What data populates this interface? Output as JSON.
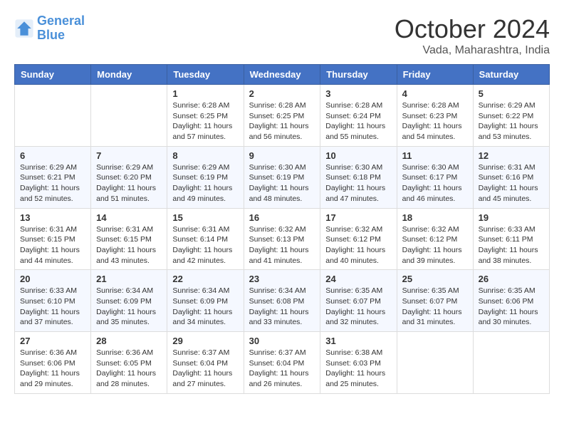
{
  "logo": {
    "line1": "General",
    "line2": "Blue"
  },
  "title": "October 2024",
  "location": "Vada, Maharashtra, India",
  "weekdays": [
    "Sunday",
    "Monday",
    "Tuesday",
    "Wednesday",
    "Thursday",
    "Friday",
    "Saturday"
  ],
  "weeks": [
    [
      {
        "day": "",
        "sunrise": "",
        "sunset": "",
        "daylight": ""
      },
      {
        "day": "",
        "sunrise": "",
        "sunset": "",
        "daylight": ""
      },
      {
        "day": "1",
        "sunrise": "Sunrise: 6:28 AM",
        "sunset": "Sunset: 6:25 PM",
        "daylight": "Daylight: 11 hours and 57 minutes."
      },
      {
        "day": "2",
        "sunrise": "Sunrise: 6:28 AM",
        "sunset": "Sunset: 6:25 PM",
        "daylight": "Daylight: 11 hours and 56 minutes."
      },
      {
        "day": "3",
        "sunrise": "Sunrise: 6:28 AM",
        "sunset": "Sunset: 6:24 PM",
        "daylight": "Daylight: 11 hours and 55 minutes."
      },
      {
        "day": "4",
        "sunrise": "Sunrise: 6:28 AM",
        "sunset": "Sunset: 6:23 PM",
        "daylight": "Daylight: 11 hours and 54 minutes."
      },
      {
        "day": "5",
        "sunrise": "Sunrise: 6:29 AM",
        "sunset": "Sunset: 6:22 PM",
        "daylight": "Daylight: 11 hours and 53 minutes."
      }
    ],
    [
      {
        "day": "6",
        "sunrise": "Sunrise: 6:29 AM",
        "sunset": "Sunset: 6:21 PM",
        "daylight": "Daylight: 11 hours and 52 minutes."
      },
      {
        "day": "7",
        "sunrise": "Sunrise: 6:29 AM",
        "sunset": "Sunset: 6:20 PM",
        "daylight": "Daylight: 11 hours and 51 minutes."
      },
      {
        "day": "8",
        "sunrise": "Sunrise: 6:29 AM",
        "sunset": "Sunset: 6:19 PM",
        "daylight": "Daylight: 11 hours and 49 minutes."
      },
      {
        "day": "9",
        "sunrise": "Sunrise: 6:30 AM",
        "sunset": "Sunset: 6:19 PM",
        "daylight": "Daylight: 11 hours and 48 minutes."
      },
      {
        "day": "10",
        "sunrise": "Sunrise: 6:30 AM",
        "sunset": "Sunset: 6:18 PM",
        "daylight": "Daylight: 11 hours and 47 minutes."
      },
      {
        "day": "11",
        "sunrise": "Sunrise: 6:30 AM",
        "sunset": "Sunset: 6:17 PM",
        "daylight": "Daylight: 11 hours and 46 minutes."
      },
      {
        "day": "12",
        "sunrise": "Sunrise: 6:31 AM",
        "sunset": "Sunset: 6:16 PM",
        "daylight": "Daylight: 11 hours and 45 minutes."
      }
    ],
    [
      {
        "day": "13",
        "sunrise": "Sunrise: 6:31 AM",
        "sunset": "Sunset: 6:15 PM",
        "daylight": "Daylight: 11 hours and 44 minutes."
      },
      {
        "day": "14",
        "sunrise": "Sunrise: 6:31 AM",
        "sunset": "Sunset: 6:15 PM",
        "daylight": "Daylight: 11 hours and 43 minutes."
      },
      {
        "day": "15",
        "sunrise": "Sunrise: 6:31 AM",
        "sunset": "Sunset: 6:14 PM",
        "daylight": "Daylight: 11 hours and 42 minutes."
      },
      {
        "day": "16",
        "sunrise": "Sunrise: 6:32 AM",
        "sunset": "Sunset: 6:13 PM",
        "daylight": "Daylight: 11 hours and 41 minutes."
      },
      {
        "day": "17",
        "sunrise": "Sunrise: 6:32 AM",
        "sunset": "Sunset: 6:12 PM",
        "daylight": "Daylight: 11 hours and 40 minutes."
      },
      {
        "day": "18",
        "sunrise": "Sunrise: 6:32 AM",
        "sunset": "Sunset: 6:12 PM",
        "daylight": "Daylight: 11 hours and 39 minutes."
      },
      {
        "day": "19",
        "sunrise": "Sunrise: 6:33 AM",
        "sunset": "Sunset: 6:11 PM",
        "daylight": "Daylight: 11 hours and 38 minutes."
      }
    ],
    [
      {
        "day": "20",
        "sunrise": "Sunrise: 6:33 AM",
        "sunset": "Sunset: 6:10 PM",
        "daylight": "Daylight: 11 hours and 37 minutes."
      },
      {
        "day": "21",
        "sunrise": "Sunrise: 6:34 AM",
        "sunset": "Sunset: 6:09 PM",
        "daylight": "Daylight: 11 hours and 35 minutes."
      },
      {
        "day": "22",
        "sunrise": "Sunrise: 6:34 AM",
        "sunset": "Sunset: 6:09 PM",
        "daylight": "Daylight: 11 hours and 34 minutes."
      },
      {
        "day": "23",
        "sunrise": "Sunrise: 6:34 AM",
        "sunset": "Sunset: 6:08 PM",
        "daylight": "Daylight: 11 hours and 33 minutes."
      },
      {
        "day": "24",
        "sunrise": "Sunrise: 6:35 AM",
        "sunset": "Sunset: 6:07 PM",
        "daylight": "Daylight: 11 hours and 32 minutes."
      },
      {
        "day": "25",
        "sunrise": "Sunrise: 6:35 AM",
        "sunset": "Sunset: 6:07 PM",
        "daylight": "Daylight: 11 hours and 31 minutes."
      },
      {
        "day": "26",
        "sunrise": "Sunrise: 6:35 AM",
        "sunset": "Sunset: 6:06 PM",
        "daylight": "Daylight: 11 hours and 30 minutes."
      }
    ],
    [
      {
        "day": "27",
        "sunrise": "Sunrise: 6:36 AM",
        "sunset": "Sunset: 6:06 PM",
        "daylight": "Daylight: 11 hours and 29 minutes."
      },
      {
        "day": "28",
        "sunrise": "Sunrise: 6:36 AM",
        "sunset": "Sunset: 6:05 PM",
        "daylight": "Daylight: 11 hours and 28 minutes."
      },
      {
        "day": "29",
        "sunrise": "Sunrise: 6:37 AM",
        "sunset": "Sunset: 6:04 PM",
        "daylight": "Daylight: 11 hours and 27 minutes."
      },
      {
        "day": "30",
        "sunrise": "Sunrise: 6:37 AM",
        "sunset": "Sunset: 6:04 PM",
        "daylight": "Daylight: 11 hours and 26 minutes."
      },
      {
        "day": "31",
        "sunrise": "Sunrise: 6:38 AM",
        "sunset": "Sunset: 6:03 PM",
        "daylight": "Daylight: 11 hours and 25 minutes."
      },
      {
        "day": "",
        "sunrise": "",
        "sunset": "",
        "daylight": ""
      },
      {
        "day": "",
        "sunrise": "",
        "sunset": "",
        "daylight": ""
      }
    ]
  ]
}
